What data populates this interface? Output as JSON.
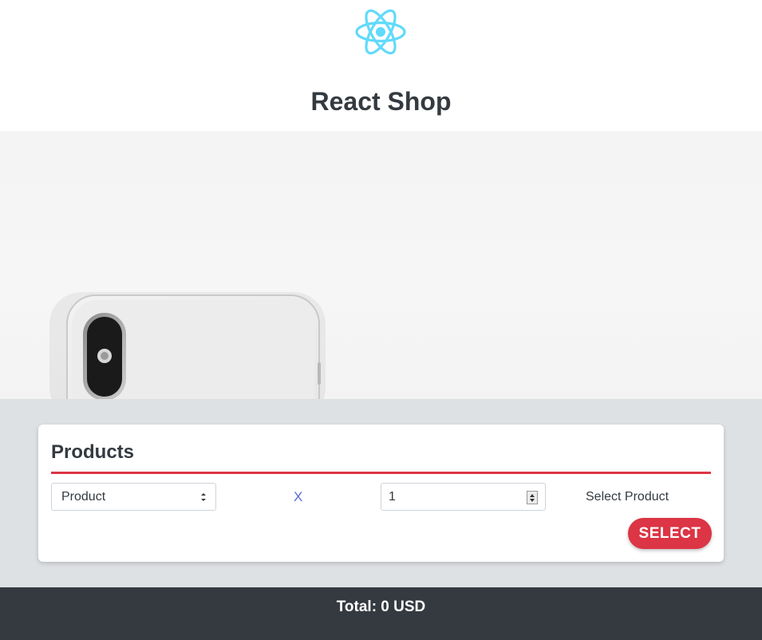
{
  "app": {
    "title": "React Shop",
    "logo_icon": "react-atom-icon",
    "logo_color": "#61dafb"
  },
  "hero": {
    "image": "white-phone-back-camera"
  },
  "products": {
    "heading": "Products",
    "accent_color": "#dc3545",
    "row": {
      "product_select_value": "Product",
      "remove_label": "X",
      "quantity_value": "1",
      "status_text": "Select Product"
    },
    "select_button_label": "SELECT"
  },
  "footer": {
    "total_text": "Total: 0 USD",
    "background_color": "#343a40"
  }
}
